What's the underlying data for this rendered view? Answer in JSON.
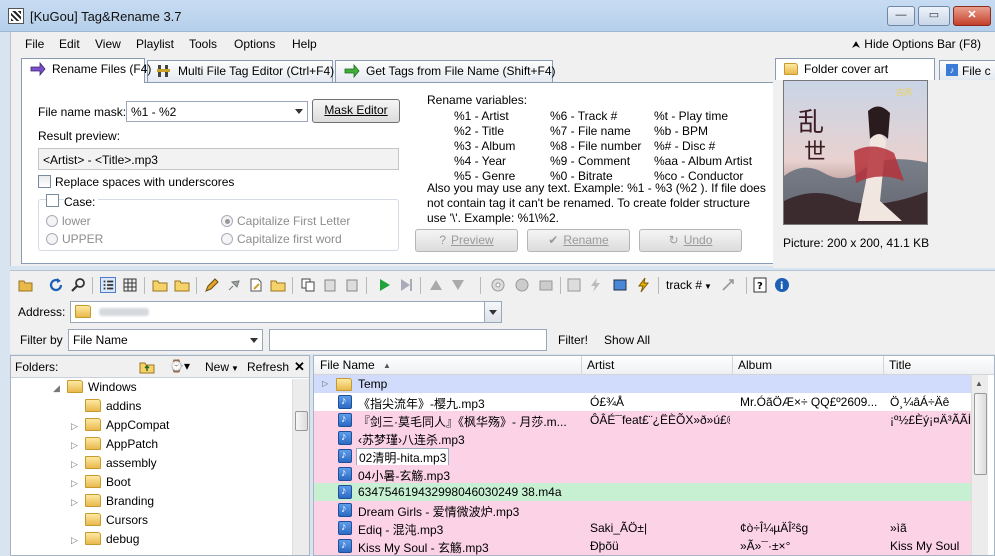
{
  "window": {
    "title": "[KuGou] Tag&Rename 3.7",
    "minimize": "—",
    "maximize": "▭",
    "close": "✕"
  },
  "menu": {
    "items": [
      "File",
      "Edit",
      "View",
      "Playlist",
      "Tools",
      "Options",
      "Help"
    ],
    "hide_options": "Hide Options Bar (F8)"
  },
  "tabs": {
    "rename": "Rename Files (F4)",
    "multi": "Multi File Tag Editor (Ctrl+F4)",
    "gettags": "Get Tags from File Name (Shift+F4)"
  },
  "rename": {
    "mask_label": "File name mask:",
    "mask_value": "%1 - %2",
    "mask_editor": "Mask Editor",
    "result_label": "Result preview:",
    "result_value": "<Artist> - <Title>.mp3",
    "replace_spaces": "Replace spaces with underscores",
    "case_label": "Case:",
    "lower": "lower",
    "upper": "UPPER",
    "cap_first_letter": "Capitalize First Letter",
    "cap_first_word": "Capitalize first word",
    "vars_title": "Rename variables:",
    "vars_col1": [
      "%1 - Artist",
      "%2 - Title",
      "%3 - Album",
      "%4 - Year",
      "%5 - Genre"
    ],
    "vars_col2": [
      "%6 - Track #",
      "%7 - File name",
      "%8 - File number",
      "%9 - Comment",
      "%0 - Bitrate"
    ],
    "vars_col3": [
      "%t - Play time",
      "%b - BPM",
      "%# - Disc #",
      "%aa - Album Artist",
      "%co - Conductor"
    ],
    "info_line1": "Also you may use any text. Example: %1 - %3 (%2 ). If file does",
    "info_line2": "not contain tag it can't be renamed. To create folder structure",
    "info_line3": "use '\\'. Example: %1\\%2.",
    "preview_btn": "Preview",
    "rename_btn": "Rename",
    "undo_btn": "Undo"
  },
  "cover": {
    "tab1": "Folder cover art",
    "tab2": "File c",
    "picture_info": "Picture: 200 x 200, 41.1 KB"
  },
  "toolbar": {
    "track_label": "track #"
  },
  "address": {
    "label": "Address:"
  },
  "filter": {
    "label": "Filter by",
    "field": "File Name",
    "filter_btn": "Filter!",
    "show_all": "Show All"
  },
  "folders": {
    "label": "Folders:",
    "new_btn": "New",
    "refresh_btn": "Refresh",
    "items": [
      {
        "name": "Windows",
        "expanded": true
      },
      {
        "name": "addins"
      },
      {
        "name": "AppCompat"
      },
      {
        "name": "AppPatch"
      },
      {
        "name": "assembly"
      },
      {
        "name": "Boot"
      },
      {
        "name": "Branding"
      },
      {
        "name": "Cursors"
      },
      {
        "name": "debug"
      }
    ]
  },
  "files": {
    "columns": [
      "File Name",
      "Artist",
      "Album",
      "Title"
    ],
    "folder_row": "Temp",
    "rows": [
      {
        "name": "《指尖流年》-樱九.mp3",
        "artist": "Ó£¾Å",
        "album": "Mr.ÓãÖÆ×÷  QQ£º2609...",
        "title": "Ö¸¼âÁ÷Äê"
      },
      {
        "name": "『剑三·莫毛同人』《枫华殇》- 月莎.m...",
        "artist": "ÔÂÉ¯feat£¨¿ËÈÕX»ð»ú£©",
        "album": "",
        "title": "¡º½£Èý¡¤Ä³ÃÃÍ¬"
      },
      {
        "name": "‹苏梦瑾›八连杀.mp3",
        "artist": "",
        "album": "",
        "title": ""
      },
      {
        "name": "02清明-hita.mp3",
        "artist": "",
        "album": "",
        "title": ""
      },
      {
        "name": "04小暑-玄觞.mp3",
        "artist": "",
        "album": "",
        "title": ""
      },
      {
        "name": "634754619432998046030249 38.m4a",
        "artist": "",
        "album": "",
        "title": ""
      },
      {
        "name": "Dream Girls - 爱情微波炉.mp3",
        "artist": "",
        "album": "",
        "title": ""
      },
      {
        "name": "Ediq - 混沌.mp3",
        "artist": "Saki_ÃÖ±|",
        "album": "¢ò÷Î¼µÄÎ²ŝg",
        "title": "»ìã"
      },
      {
        "name": "Kiss My Soul - 玄觞.mp3",
        "artist": "Ðþõü",
        "album": "»Ã»¯·±×°",
        "title": "Kiss My Soul"
      }
    ]
  },
  "colors": {
    "row_pink": "#fbd2e6",
    "row_green": "#c7f0d2",
    "row_folder": "#d1dbfb",
    "accent": "#3a7bd5"
  }
}
